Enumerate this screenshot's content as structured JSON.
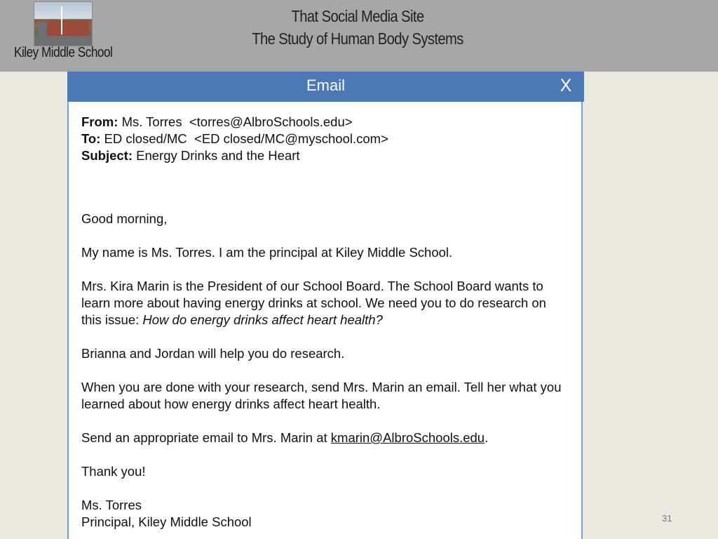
{
  "banner": {
    "school_name": "Kiley Middle School",
    "title_line1": "That Social Media Site",
    "title_line2": "The Study of Human Body Systems"
  },
  "email": {
    "window_title": "Email",
    "close_label": "X",
    "from_label": "From:",
    "from_value": "Ms. Torres  <torres@AlbroSchools.edu>",
    "to_label": "To:",
    "to_value": "ED closed/MC  <ED closed/MC@myschool.com>",
    "subject_label": "Subject:",
    "subject_value": "Energy Drinks and the Heart",
    "greeting": "Good morning,",
    "p1": "My name is Ms. Torres. I am the principal at Kiley Middle School.",
    "p2_a": "Mrs. Kira Marin is the President of our School Board. The School Board wants to learn more about having energy drinks at school. We need you to do research on this issue: ",
    "p2_italic": "How do energy drinks affect heart health?",
    "p3": "Brianna and Jordan will help you do research.",
    "p4": "When you are done with your research, send Mrs. Marin an email. Tell her what you learned about how energy drinks affect heart health.",
    "p5_a": "Send an appropriate email to Mrs. Marin at ",
    "p5_link": "kmarin@AlbroSchools.edu",
    "p5_b": ".",
    "p6": "Thank you!",
    "sig_name": "Ms. Torres",
    "sig_title": "Principal, Kiley Middle School"
  },
  "page_number": "31",
  "colors": {
    "titlebar": "#4d78b6",
    "banner": "#a7a7a7",
    "background": "#ece9e0"
  }
}
